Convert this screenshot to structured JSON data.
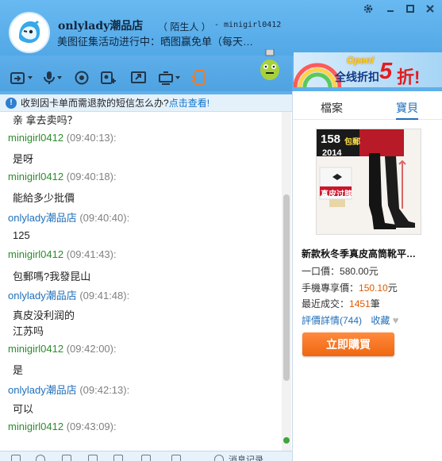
{
  "window": {
    "shop_name": "onlylady潮品店",
    "status": "（ 陌生人 ）",
    "account": "- minigirl0412",
    "signature": "美图征集活动进行中：晒图赢免单（每天…",
    "controls": [
      "settings",
      "minimize",
      "maximize",
      "close"
    ]
  },
  "toolbar": {
    "icons": [
      "transfer-file-icon",
      "microphone-icon",
      "video-call-icon",
      "add-contact-icon",
      "remote-desktop-icon",
      "app-icon",
      "mobile-icon"
    ]
  },
  "ad": {
    "open": "Open!",
    "text": "全线折扣",
    "discount": "5",
    "unit": "折!"
  },
  "notice": {
    "text": "收到因卡单而需退款的短信怎么办?",
    "link": "点击查看!"
  },
  "chat": {
    "messages": [
      {
        "type": "text",
        "text": "亲 拿去卖吗？"
      },
      {
        "type": "header",
        "sender": "minigirl0412",
        "role": "me",
        "time": "(09:40:13):"
      },
      {
        "type": "text",
        "text": "是呀"
      },
      {
        "type": "header",
        "sender": "minigirl0412",
        "role": "me",
        "time": "(09:40:18):"
      },
      {
        "type": "text",
        "text": "能給多少批價"
      },
      {
        "type": "header",
        "sender": "onlylady潮品店",
        "role": "shop",
        "time": "(09:40:40):"
      },
      {
        "type": "text",
        "text": "125"
      },
      {
        "type": "header",
        "sender": "minigirl0412",
        "role": "me",
        "time": "(09:41:43):"
      },
      {
        "type": "text",
        "text": "包郵嗎?我發昆山"
      },
      {
        "type": "header",
        "sender": "onlylady潮品店",
        "role": "shop",
        "time": "(09:41:48):"
      },
      {
        "type": "text",
        "text": "真皮没利润的"
      },
      {
        "type": "text",
        "text": "江苏吗"
      },
      {
        "type": "header",
        "sender": "minigirl0412",
        "role": "me",
        "time": "(09:42:00):"
      },
      {
        "type": "text",
        "text": "是"
      },
      {
        "type": "header",
        "sender": "onlylady潮品店",
        "role": "shop",
        "time": "(09:42:13):"
      },
      {
        "type": "text",
        "text": "可以"
      },
      {
        "type": "header",
        "sender": "minigirl0412",
        "role": "me",
        "time": "(09:43:09):"
      }
    ]
  },
  "bottom_bar": {
    "label": "消息记录"
  },
  "side_panel": {
    "tabs": [
      "檔案",
      "寶貝"
    ],
    "active_tab": "寶貝",
    "product": {
      "badge_price": "158",
      "badge_text": "包郵",
      "year": "2014",
      "promo": "真皮过膝",
      "title": "新款秋冬季真皮高筒靴平…",
      "price_label": "一口價：",
      "price": "580.00元",
      "mobile_label": "手機專享價：",
      "mobile_price": "150.10",
      "mobile_unit": "元",
      "sold_label": "最近成交：",
      "sold": "1451",
      "sold_unit": "筆",
      "reviews": "評價詳情(744)",
      "favorite": "收藏",
      "buy": "立即購買"
    }
  }
}
